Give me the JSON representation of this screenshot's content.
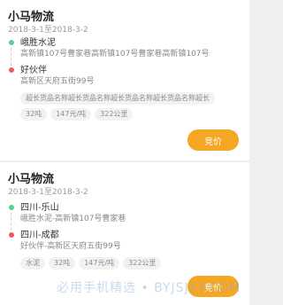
{
  "cards": [
    {
      "title": "小马物流",
      "date": "2018-3-1至2018-3-2",
      "stops": [
        {
          "name": "峨胜水泥",
          "address": "高新镇107号曹家巷高新镇107号曹家巷高新镇107号"
        },
        {
          "name": "好伙伴",
          "address": "高新区天府五街99号"
        }
      ],
      "tags": [
        "超长货品名称超长货品名称超长货品名称超长货品名称超长",
        "32吨",
        "147元/吨",
        "322公里"
      ],
      "button": "竞价"
    },
    {
      "title": "小马物流",
      "date": "2018-3-1至2018-3-2",
      "stops": [
        {
          "name": "四川-乐山",
          "address": "峨胜水泥-高新镇107号曹家巷"
        },
        {
          "name": "四川-成都",
          "address": "好伙伴-高新区天府五街99号"
        }
      ],
      "tags": [
        "水泥",
        "32吨",
        "147元/吨",
        "322公里"
      ],
      "button": "竞价"
    }
  ],
  "watermark": "必用手机精选 • BYJSJXY.COM",
  "colors": {
    "accent": "#f5a623",
    "origin_dot": "#5ad08c",
    "destination_dot": "#ef5a5a"
  }
}
